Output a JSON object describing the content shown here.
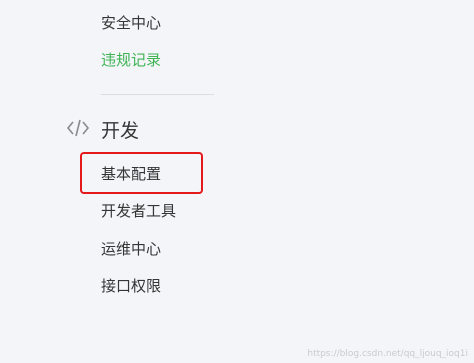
{
  "menu": {
    "security_center": "安全中心",
    "violation_records": "违规记录",
    "dev_section": {
      "icon": "code-icon",
      "title": "开发",
      "items": [
        {
          "label": "基本配置"
        },
        {
          "label": "开发者工具"
        },
        {
          "label": "运维中心"
        },
        {
          "label": "接口权限"
        }
      ]
    }
  },
  "colors": {
    "text": "#353535",
    "green_link": "#3fb455",
    "highlight": "#e3191c",
    "background": "#f4f5f9"
  },
  "watermark": "https://blog.csdn.net/qq_ljouq_ioq1i"
}
